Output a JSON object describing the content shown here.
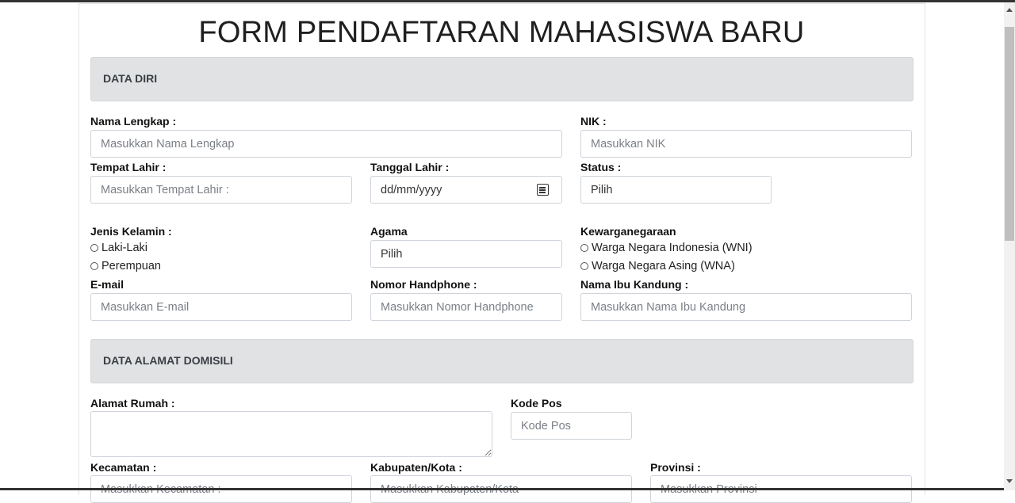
{
  "title": "FORM PENDAFTARAN MAHASISWA BARU",
  "sections": {
    "data_diri": "DATA DIRI",
    "alamat": "DATA ALAMAT DOMISILI"
  },
  "fields": {
    "nama": {
      "label": "Nama Lengkap :",
      "placeholder": "Masukkan Nama Lengkap"
    },
    "nik": {
      "label": "NIK :",
      "placeholder": "Masukkan NIK"
    },
    "tempat_lahir": {
      "label": "Tempat Lahir :",
      "placeholder": "Masukkan Tempat Lahir :"
    },
    "tanggal_lahir": {
      "label": "Tanggal Lahir :",
      "value": "dd/mm/yyyy"
    },
    "status": {
      "label": "Status :",
      "value": "Pilih"
    },
    "jenis_kelamin": {
      "label": "Jenis Kelamin :",
      "options": [
        "Laki-Laki",
        "Perempuan"
      ]
    },
    "agama": {
      "label": "Agama",
      "value": "Pilih"
    },
    "kewarganegaraan": {
      "label": "Kewarganegaraan",
      "options": [
        "Warga Negara Indonesia (WNI)",
        "Warga Negara Asing (WNA)"
      ]
    },
    "email": {
      "label": "E-mail",
      "placeholder": "Masukkan E-mail"
    },
    "nomor_hp": {
      "label": "Nomor Handphone :",
      "placeholder": "Masukkan Nomor Handphone"
    },
    "nama_ibu": {
      "label": "Nama Ibu Kandung :",
      "placeholder": "Masukkan Nama Ibu Kandung"
    },
    "alamat_rumah": {
      "label": "Alamat Rumah :",
      "value": ""
    },
    "kode_pos": {
      "label": "Kode Pos",
      "placeholder": "Kode Pos"
    },
    "kecamatan": {
      "label": "Kecamatan :",
      "placeholder": "Masukkan Kecamatan :"
    },
    "kabupaten": {
      "label": "Kabupaten/Kota :",
      "placeholder": "Masukkan Kabupaten/Kota"
    },
    "provinsi": {
      "label": "Provinsi :",
      "placeholder": "Masukkan Provinsi"
    }
  },
  "icons": {
    "calendar": "calendar-icon"
  }
}
